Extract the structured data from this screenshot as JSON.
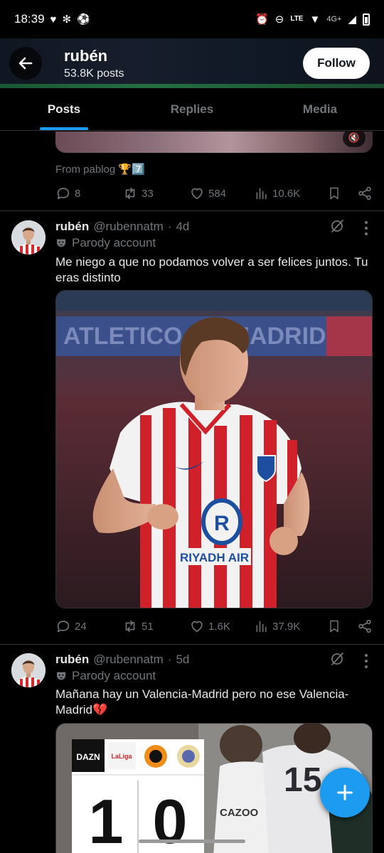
{
  "status_bar": {
    "time": "18:39",
    "network": "4G+"
  },
  "profile": {
    "name": "rubén",
    "posts_count": "53.8K posts",
    "follow_label": "Follow"
  },
  "tabs": [
    {
      "label": "Posts",
      "active": true
    },
    {
      "label": "Replies",
      "active": false
    },
    {
      "label": "Media",
      "active": false
    }
  ],
  "previous_post": {
    "source_line": "From pablog 🏆7️⃣",
    "stats": {
      "replies": "8",
      "reposts": "33",
      "likes": "584",
      "views": "10.6K"
    }
  },
  "posts": [
    {
      "name": "rubén",
      "handle": "@rubennatm",
      "separator": "·",
      "time": "4d",
      "badge": "Parody account",
      "text": "Me niego a que no podamos volver a ser felices juntos. Tu eras distinto",
      "image_text": {
        "banner": "ATLETICO DE MADRID",
        "sponsor": "RIYADH AIR"
      },
      "stats": {
        "replies": "24",
        "reposts": "51",
        "likes": "1.6K",
        "views": "37.9K"
      }
    },
    {
      "name": "rubén",
      "handle": "@rubennatm",
      "separator": "·",
      "time": "5d",
      "badge": "Parody account",
      "text": "Mañana hay un Valencia-Madrid pero no ese Valencia-Madrid💔",
      "image_text": {
        "score_home": "1",
        "score_away": "0",
        "broadcaster": "DAZN",
        "league": "LaLiga",
        "shirt_sponsor": "CAZOO",
        "shirt_number": "15"
      }
    }
  ],
  "colors": {
    "accent": "#1d9bf0",
    "text_primary": "#e7e9ea",
    "text_secondary": "#71767b",
    "divider": "#2f3336"
  }
}
